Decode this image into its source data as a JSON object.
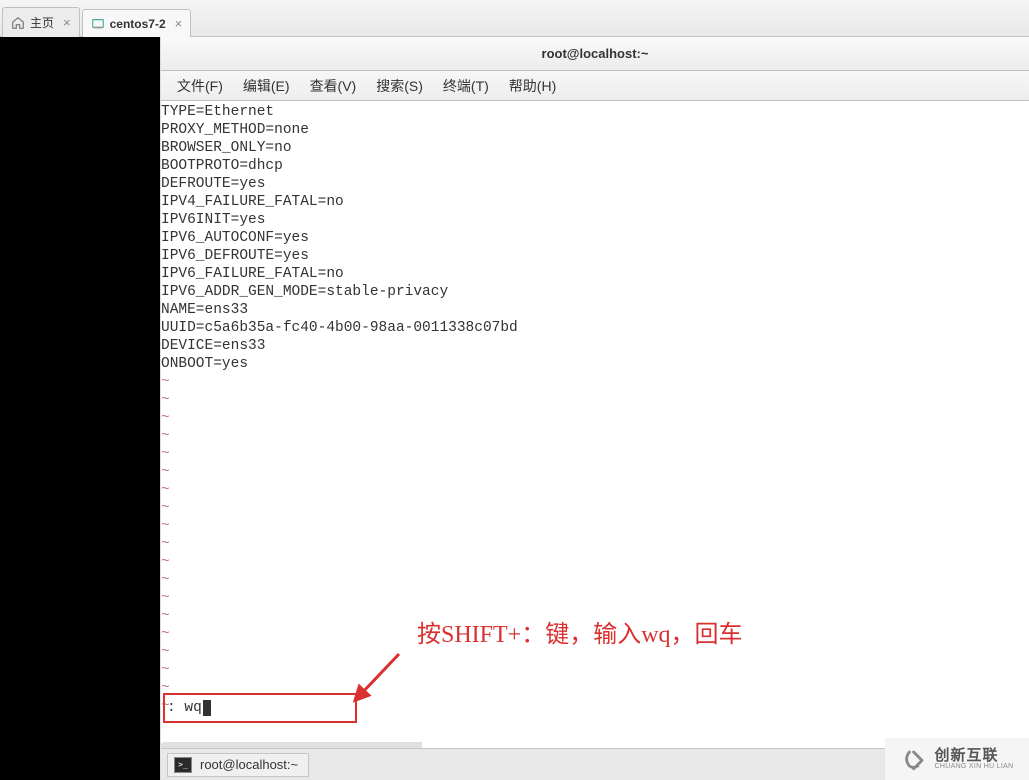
{
  "tabs": [
    {
      "label": "主页"
    },
    {
      "label": "centos7-2"
    }
  ],
  "window": {
    "title": "root@localhost:~"
  },
  "menu": {
    "file": "文件(F)",
    "edit": "编辑(E)",
    "view": "查看(V)",
    "search": "搜索(S)",
    "terminal": "终端(T)",
    "help": "帮助(H)"
  },
  "terminal": {
    "file_lines": [
      "TYPE=Ethernet",
      "PROXY_METHOD=none",
      "BROWSER_ONLY=no",
      "BOOTPROTO=dhcp",
      "DEFROUTE=yes",
      "IPV4_FAILURE_FATAL=no",
      "IPV6INIT=yes",
      "IPV6_AUTOCONF=yes",
      "IPV6_DEFROUTE=yes",
      "IPV6_FAILURE_FATAL=no",
      "IPV6_ADDR_GEN_MODE=stable-privacy",
      "NAME=ens33",
      "UUID=c5a6b35a-fc40-4b00-98aa-0011338c07bd",
      "DEVICE=ens33",
      "ONBOOT=yes"
    ],
    "tilde_count": 19,
    "command_prefix": ":",
    "command_value": "wq"
  },
  "annotation": {
    "text": "按SHIFT+：键，输入wq，回车"
  },
  "taskbar": {
    "item_label": "root@localhost:~"
  },
  "watermark": {
    "cn": "创新互联",
    "en": "CHUANG XIN HU LIAN"
  }
}
